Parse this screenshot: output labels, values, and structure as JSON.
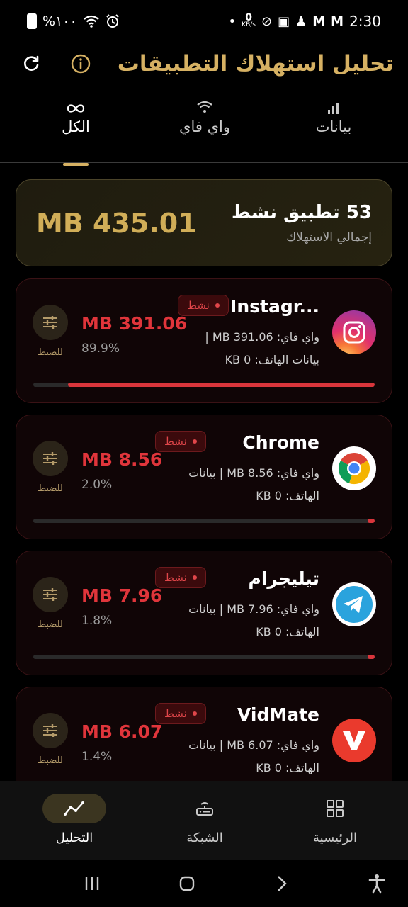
{
  "status_bar": {
    "battery_percent": "%١٠٠",
    "time": "2:30",
    "net_speed_value": "0",
    "net_speed_unit": "KB/s"
  },
  "header": {
    "title": "تحليل استهلاك التطبيقات"
  },
  "tabs": [
    {
      "label": "الكل",
      "icon": "infinity-icon",
      "active": true
    },
    {
      "label": "واي فاي",
      "icon": "wifi-icon",
      "active": false
    },
    {
      "label": "بيانات",
      "icon": "signal-bars-icon",
      "active": false
    }
  ],
  "summary": {
    "total": "MB 435.01",
    "active_count": "53 تطبيق نشط",
    "label": "إجمالي الاستهلاك"
  },
  "apps": [
    {
      "name": "Instagr...",
      "icon": "instagram-icon",
      "badge": "نشط",
      "line1": "واي فاي: MB 391.06  |",
      "line2": "بيانات الهاتف: KB 0",
      "usage": "MB 391.06",
      "percent": "89.9%",
      "progress": 0.899,
      "adjust_label": "للضبط"
    },
    {
      "name": "Chrome",
      "icon": "chrome-icon",
      "badge": "نشط",
      "line1": "واي فاي: MB 8.56  |  بيانات",
      "line2": "الهاتف: KB 0",
      "usage": "MB 8.56",
      "percent": "2.0%",
      "progress": 0.02,
      "adjust_label": "للضبط"
    },
    {
      "name": "تيليجرام",
      "icon": "telegram-icon",
      "badge": "نشط",
      "line1": "واي فاي: MB 7.96  |  بيانات",
      "line2": "الهاتف: KB 0",
      "usage": "MB 7.96",
      "percent": "1.8%",
      "progress": 0.018,
      "adjust_label": "للضبط"
    },
    {
      "name": "VidMate",
      "icon": "vidmate-icon",
      "badge": "نشط",
      "line1": "واي فاي: MB 6.07  |  بيانات",
      "line2": "الهاتف: KB 0",
      "usage": "MB 6.07",
      "percent": "1.4%",
      "progress": 0.014,
      "adjust_label": "للضبط"
    }
  ],
  "bottom_nav": [
    {
      "label": "التحليل",
      "icon": "analytics-icon",
      "active": true
    },
    {
      "label": "الشبكة",
      "icon": "router-icon",
      "active": false
    },
    {
      "label": "الرئيسية",
      "icon": "grid-icon",
      "active": false
    }
  ],
  "colors": {
    "accent_gold": "#d6b163",
    "usage_red": "#e0353b",
    "background": "#000000"
  }
}
